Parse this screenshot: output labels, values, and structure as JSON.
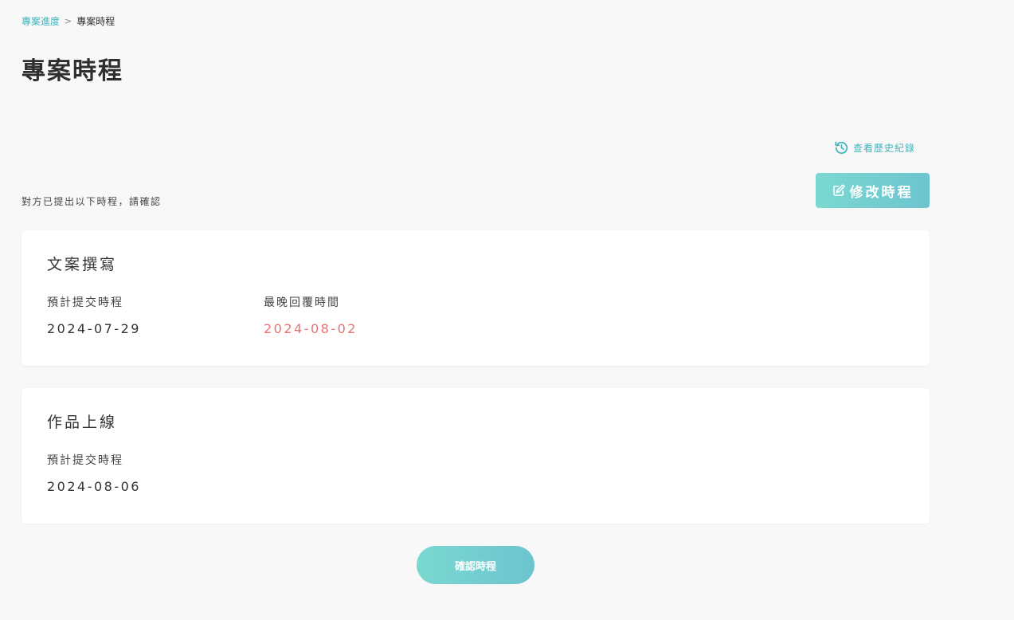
{
  "breadcrumb": {
    "parent": "專案進度",
    "separator": ">",
    "current": "專案時程"
  },
  "page_title": "專案時程",
  "history_link": {
    "label": "查看歷史紀錄",
    "icon": "history-icon"
  },
  "edit_button": {
    "label": "修改時程",
    "icon": "edit-icon"
  },
  "notice": "對方已提出以下時程，請確認",
  "cards": [
    {
      "title": "文案撰寫",
      "fields": [
        {
          "label": "預計提交時程",
          "value": "2024-07-29"
        },
        {
          "label": "最晚回覆時間",
          "value": "2024-08-02",
          "color": "#e57373"
        }
      ]
    },
    {
      "title": "作品上線",
      "fields": [
        {
          "label": "預計提交時程",
          "value": "2024-08-06"
        }
      ]
    }
  ],
  "confirm_button": {
    "label": "確認時程"
  },
  "colors": {
    "accent": "#3fb6bf",
    "button_gradient_start": "#7bd8d0",
    "button_gradient_end": "#6cc4cf",
    "late": "#e57373",
    "background": "#f8f8f8"
  }
}
